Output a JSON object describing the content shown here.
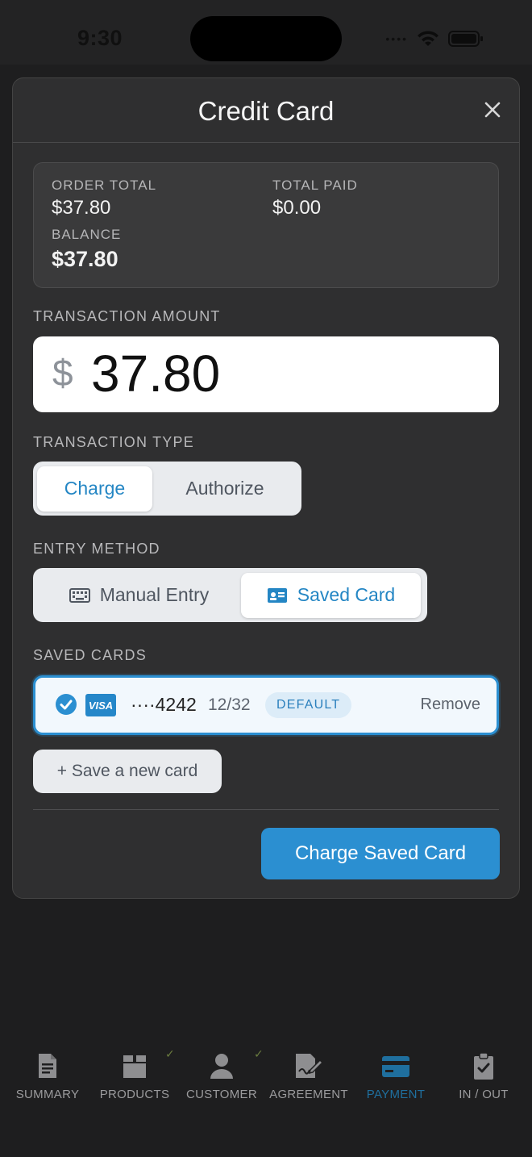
{
  "status_bar": {
    "time": "9:30"
  },
  "modal": {
    "title": "Credit Card",
    "close_label": "×"
  },
  "summary": {
    "order_total_label": "ORDER TOTAL",
    "order_total_value": "$37.80",
    "total_paid_label": "TOTAL PAID",
    "total_paid_value": "$0.00",
    "balance_label": "BALANCE",
    "balance_value": "$37.80"
  },
  "transaction_amount": {
    "label": "TRANSACTION AMOUNT",
    "currency": "$",
    "value": "37.80"
  },
  "transaction_type": {
    "label": "TRANSACTION TYPE",
    "options": [
      "Charge",
      "Authorize"
    ],
    "selected": "Charge"
  },
  "entry_method": {
    "label": "ENTRY METHOD",
    "options": [
      "Manual Entry",
      "Saved Card"
    ],
    "selected": "Saved Card"
  },
  "saved_cards": {
    "label": "SAVED CARDS",
    "items": [
      {
        "brand": "VISA",
        "number": "····4242",
        "expiry": "12/32",
        "badge": "DEFAULT",
        "remove_label": "Remove",
        "selected": true
      }
    ]
  },
  "save_new_card_label": "+ Save a new card",
  "charge_button_label": "Charge Saved Card",
  "colors": {
    "accent": "#2b8fd1",
    "modal_bg": "#2f2f30",
    "page_bg": "#1e1e1f",
    "nav_active": "#1f6f9e"
  },
  "bottom_nav": {
    "items": [
      {
        "label": "SUMMARY",
        "icon": "document-icon",
        "checked": false
      },
      {
        "label": "PRODUCTS",
        "icon": "box-icon",
        "checked": true
      },
      {
        "label": "CUSTOMER",
        "icon": "user-icon",
        "checked": true
      },
      {
        "label": "AGREEMENT",
        "icon": "signature-icon",
        "checked": false
      },
      {
        "label": "PAYMENT",
        "icon": "credit-card-icon",
        "checked": false,
        "active": true
      },
      {
        "label": "IN / OUT",
        "icon": "clipboard-check-icon",
        "checked": false
      }
    ]
  }
}
